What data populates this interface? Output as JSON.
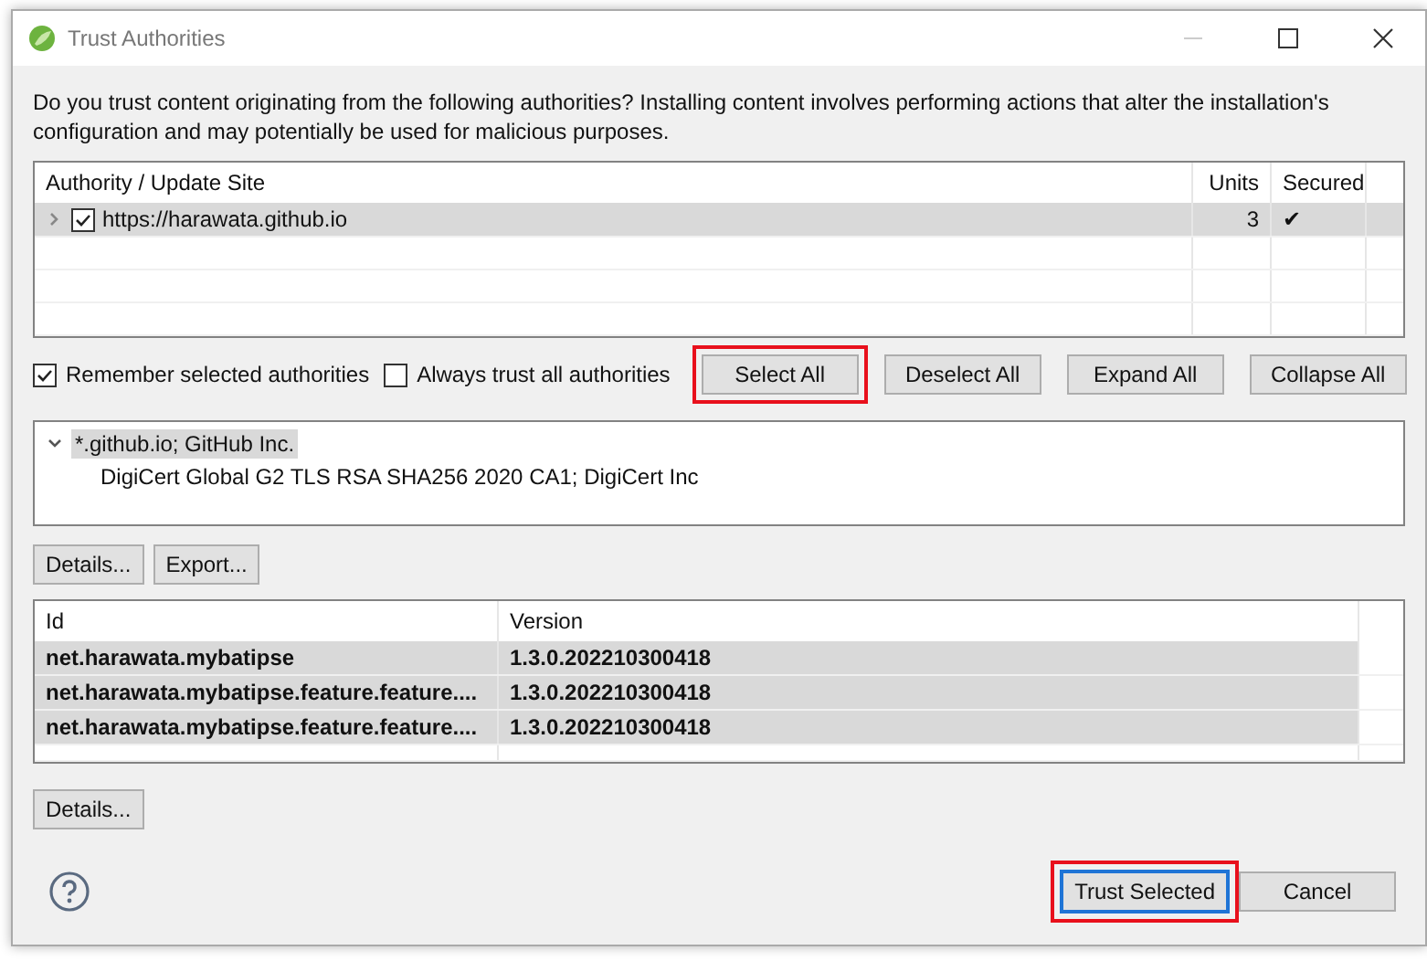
{
  "window": {
    "title": "Trust Authorities"
  },
  "message": "Do you trust content originating from the following authorities?  Installing content involves performing actions that alter the installation's configuration and may potentially be used for malicious purposes.",
  "authorities": {
    "columns": [
      "Authority / Update Site",
      "Units",
      "Secured"
    ],
    "rows": [
      {
        "site": "https://harawata.github.io",
        "units": "3",
        "secured": "✔",
        "checked": true,
        "expanded": false,
        "selected": true
      }
    ]
  },
  "options": [
    {
      "label": "Remember selected authorities",
      "checked": true
    },
    {
      "label": "Always trust all authorities",
      "checked": false
    }
  ],
  "selection_buttons": [
    {
      "label": "Select All",
      "highlighted": true
    },
    {
      "label": "Deselect All",
      "highlighted": false
    },
    {
      "label": "Expand All",
      "highlighted": false
    },
    {
      "label": "Collapse All",
      "highlighted": false
    }
  ],
  "certificates": [
    {
      "label": "*.github.io; GitHub Inc.",
      "expanded": true,
      "selected": true,
      "children": [
        {
          "label": "DigiCert Global G2 TLS RSA SHA256 2020 CA1; DigiCert Inc",
          "selected": false
        }
      ]
    }
  ],
  "certificate_buttons": [
    "Details...",
    "Export..."
  ],
  "units": {
    "columns": [
      "Id",
      "Version"
    ],
    "rows": [
      {
        "id": "net.harawata.mybatipse",
        "version": "1.3.0.202210300418",
        "selected": true
      },
      {
        "id": "net.harawata.mybatipse.feature.feature....",
        "version": "1.3.0.202210300418",
        "selected": true
      },
      {
        "id": "net.harawata.mybatipse.feature.feature....",
        "version": "1.3.0.202210300418",
        "selected": true
      }
    ]
  },
  "units_buttons": [
    "Details..."
  ],
  "footer_buttons": [
    {
      "label": "Trust Selected",
      "default": true,
      "highlighted": true
    },
    {
      "label": "Cancel",
      "default": false,
      "highlighted": false
    }
  ]
}
